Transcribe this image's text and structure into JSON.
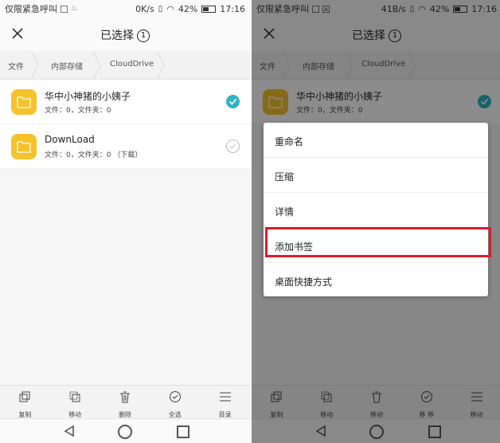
{
  "status_bar": {
    "carrier": "仅限紧急呼叫",
    "sim_badge": "A",
    "battery": "42%",
    "time": "17:16"
  },
  "screens": [
    {
      "speed": "0K/s",
      "title": "已选择",
      "count": "1",
      "breadcrumb": [
        "文件",
        "内部存储",
        "CloudDrive"
      ],
      "files": [
        {
          "name": "华中小神猪的小姨子",
          "meta": "文件：0，文件夹：0",
          "selected": true
        },
        {
          "name": "DownLoad",
          "meta": "文件：0，文件夹：0 （下载）",
          "selected": false
        }
      ],
      "toolbar": [
        "复制",
        "移动",
        "删除",
        "全选",
        "目录"
      ]
    },
    {
      "speed": "41B/s",
      "title": "已选择",
      "count": "1",
      "breadcrumb": [
        "文件",
        "内部存储",
        "CloudDrive"
      ],
      "files": [
        {
          "name": "华中小神猪的小姨子",
          "meta": "文件：0，文件夹：0",
          "selected": true
        }
      ],
      "toolbar": [
        "复制",
        "移动",
        "移动",
        "移",
        "移",
        "移动"
      ],
      "context_menu": [
        "重命名",
        "压缩",
        "详情",
        "添加书签",
        "桌面快捷方式"
      ],
      "highlighted_item": "添加书签"
    }
  ],
  "colors": {
    "accent": "#2fb3c3",
    "folder": "#f5c22b",
    "highlight": "#d81e2c"
  }
}
